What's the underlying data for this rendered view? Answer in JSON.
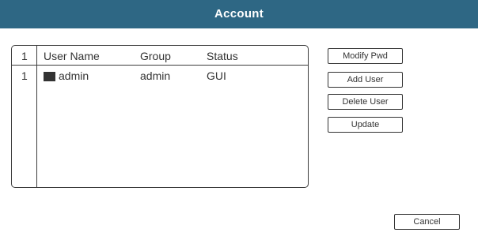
{
  "window": {
    "title": "Account"
  },
  "table": {
    "headers": {
      "num": "1",
      "user_name": "User Name",
      "group": "Group",
      "status": "Status"
    },
    "rows": [
      {
        "num": "1",
        "user_name": "admin",
        "group": "admin",
        "status": "GUI"
      }
    ]
  },
  "actions": {
    "modify_pwd": "Modify Pwd",
    "add_user": "Add User",
    "delete_user": "Delete User",
    "update": "Update",
    "cancel": "Cancel"
  },
  "colors": {
    "titlebar": "#2e6784",
    "border": "#3c3c3c",
    "text": "#333333"
  }
}
